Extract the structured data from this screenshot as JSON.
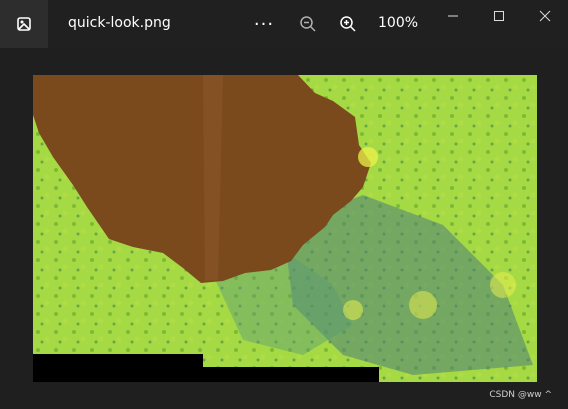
{
  "window": {
    "file_name": "quick-look.png",
    "more_label": "···",
    "zoom_level": "100%"
  },
  "icons": {
    "app": "photos-app-icon",
    "zoom_out": "zoom-out-icon",
    "zoom_in": "zoom-in-icon",
    "minimize": "minimize-icon",
    "maximize": "maximize-icon",
    "close": "close-icon"
  },
  "status": {
    "watermark": "CSDN @ww ^"
  }
}
